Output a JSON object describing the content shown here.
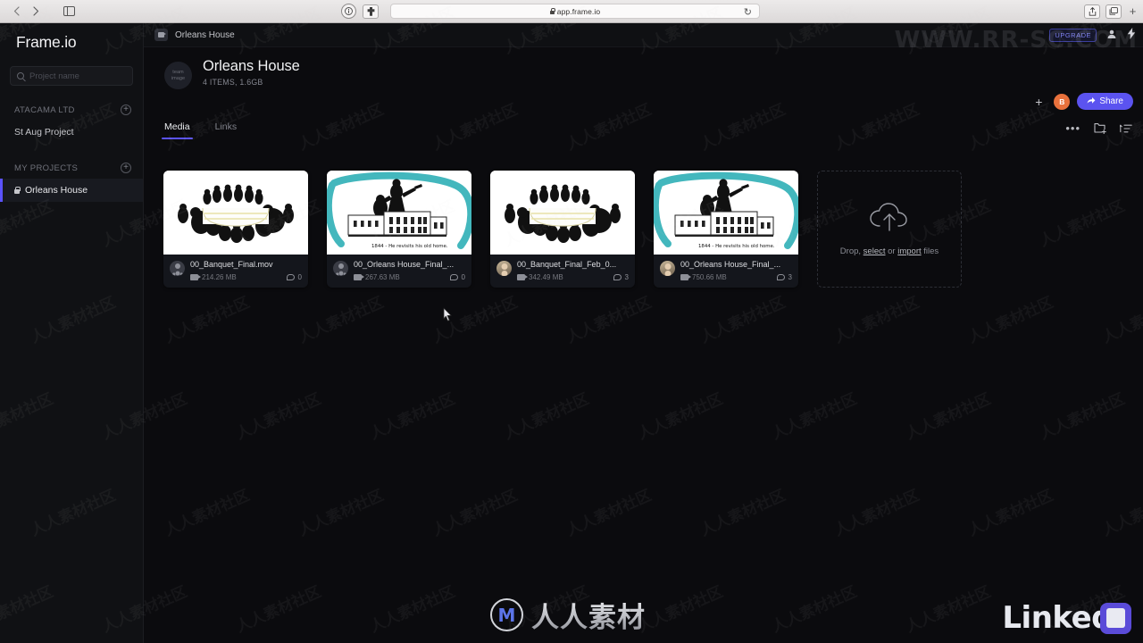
{
  "browser": {
    "back_icon": "chevron-left-icon",
    "forward_icon": "chevron-right-icon",
    "sidebar_icon": "sidebar-toggle-icon",
    "shield_icon": "privacy-report-icon",
    "extension_icon": "extension-icon",
    "url": "app.frame.io",
    "reload_glyph": "↻",
    "share_glyph": "⇧",
    "tabs_glyph": "⧉",
    "new_tab_glyph": "+"
  },
  "sidebar": {
    "brand": "Frame.io",
    "search_placeholder": "Project name",
    "search_value": "",
    "groups": [
      {
        "title": "ATACAMA LTD",
        "add_glyph": "+"
      },
      {
        "title": "MY PROJECTS",
        "add_glyph": "+"
      }
    ],
    "team_project": "St Aug Project",
    "my_project": "Orleans House"
  },
  "breadcrumb": {
    "project_name": "Orleans House"
  },
  "header": {
    "upgrade_label": "UPGRADE",
    "people_glyph": "👤",
    "bolt_glyph": "⚡",
    "team_image_line1": "team",
    "team_image_line2": "image",
    "title": "Orleans House",
    "meta": "4 ITEMS, 1.6GB",
    "add_glyph": "+",
    "avatar_initial": "B",
    "share_label": "Share",
    "share_arrow": "➦"
  },
  "tabs": [
    {
      "label": "Media",
      "active": true
    },
    {
      "label": "Links",
      "active": false
    }
  ],
  "view_tools": {
    "more_glyph": "•••",
    "new_folder_icon": "new-folder-icon",
    "sort_icon": "sort-list-icon"
  },
  "assets": [
    {
      "name": "00_Banquet_Final.mov",
      "size": "214.26 MB",
      "comments": "0",
      "thumb": "banquet",
      "avatar": "generic"
    },
    {
      "name": "00_Orleans House_Final_...",
      "size": "267.63 MB",
      "comments": "0",
      "thumb": "house",
      "avatar": "generic"
    },
    {
      "name": "00_Banquet_Final_Feb_0...",
      "size": "342.49 MB",
      "comments": "3",
      "thumb": "banquet",
      "avatar": "photo"
    },
    {
      "name": "00_Orleans House_Final_...",
      "size": "750.66 MB",
      "comments": "3",
      "thumb": "house",
      "avatar": "photo"
    }
  ],
  "drop_zone": {
    "text_before": "Drop, ",
    "link_select": "select",
    "text_middle": " or ",
    "link_import": "import",
    "text_after": " files",
    "icon": "cloud-upload-icon"
  },
  "watermarks": {
    "url_text": "WWW.RR-SC.COM",
    "center_text": "人人素材",
    "center_logo": "M",
    "tile_text": "人人素材社区",
    "linked_text": "Linked"
  },
  "colors": {
    "accent": "#5b53ff",
    "share": "#5b53f0",
    "avatar": "#e8713c",
    "sidebar_bg": "#101114",
    "main_bg": "#0b0b0e",
    "card_bg": "#14161c"
  }
}
